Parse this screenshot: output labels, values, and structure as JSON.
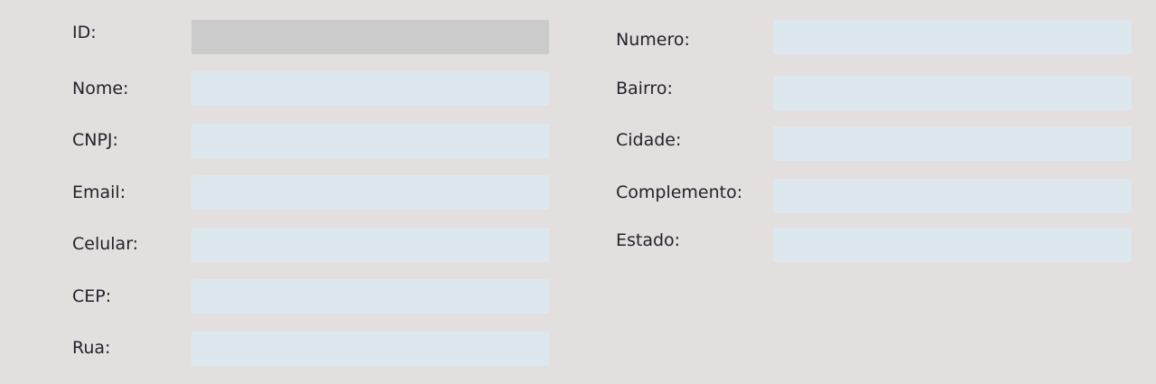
{
  "form": {
    "left_column": [
      {
        "key": "id",
        "label": "ID:",
        "value": "",
        "readonly": true
      },
      {
        "key": "nome",
        "label": "Nome:",
        "value": ""
      },
      {
        "key": "cnpj",
        "label": "CNPJ:",
        "value": ""
      },
      {
        "key": "email",
        "label": "Email:",
        "value": ""
      },
      {
        "key": "celular",
        "label": "Celular:",
        "value": ""
      },
      {
        "key": "cep",
        "label": "CEP:",
        "value": ""
      },
      {
        "key": "rua",
        "label": "Rua:",
        "value": ""
      }
    ],
    "right_column": [
      {
        "key": "numero",
        "label": "Numero:",
        "value": ""
      },
      {
        "key": "bairro",
        "label": "Bairro:",
        "value": ""
      },
      {
        "key": "cidade",
        "label": "Cidade:",
        "value": ""
      },
      {
        "key": "complemento",
        "label": "Complemento:",
        "value": ""
      },
      {
        "key": "estado",
        "label": "Estado:",
        "value": ""
      }
    ]
  },
  "colors": {
    "background": "#e3dfdf",
    "field": "#dde8ee",
    "readonly_field": "#cbcbcb",
    "text": "#25222a"
  }
}
